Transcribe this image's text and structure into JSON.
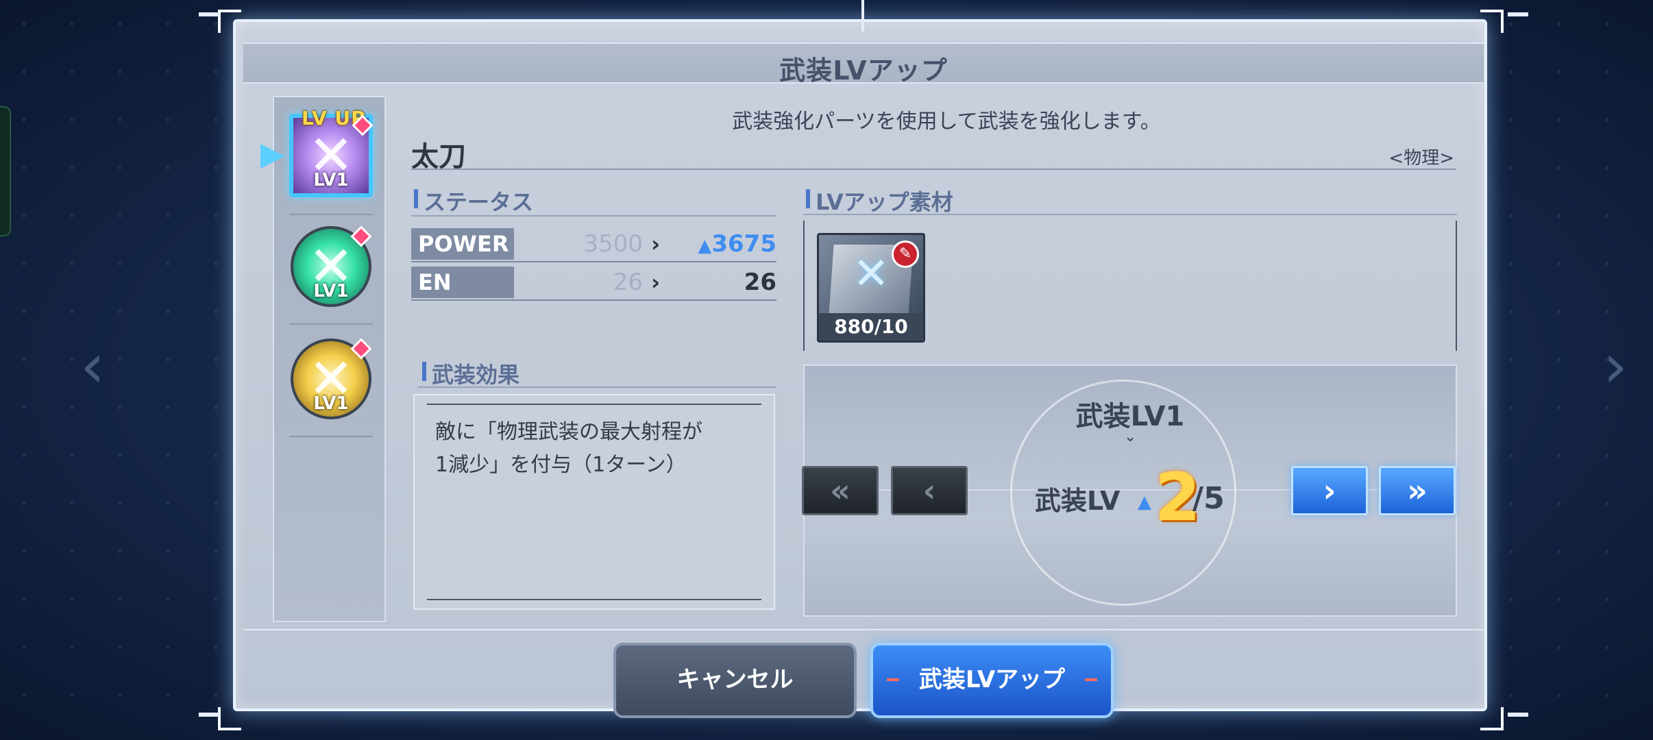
{
  "dialog": {
    "title": "武装LVアップ",
    "description": "武装強化パーツを使用して武装を強化します。"
  },
  "weapon": {
    "name": "太刀",
    "type": "<物理>"
  },
  "weapon_list": [
    {
      "level_label": "LV1",
      "color": "#c9a6ff",
      "selected": true,
      "badge": "LV UP"
    },
    {
      "level_label": "LV1",
      "color": "#35e0a8",
      "selected": false
    },
    {
      "level_label": "LV1",
      "color": "#f3cf4a",
      "selected": false
    }
  ],
  "sections": {
    "status": "ステータス",
    "material": "LVアップ素材",
    "effect": "武装効果"
  },
  "stats": [
    {
      "label": "POWER",
      "current": "3500",
      "next": "3675",
      "increased": true
    },
    {
      "label": "EN",
      "current": "26",
      "next": "26",
      "increased": false
    }
  ],
  "effect": {
    "line1": "敵に「物理武装の最大射程が",
    "line2": "1減少」を付与（1ターン）"
  },
  "material": {
    "count": "880/10",
    "icon": "feather-icon"
  },
  "level": {
    "current_label": "武装LV1",
    "target_label": "武装LV",
    "target_value": "2",
    "max_label": "/5"
  },
  "buttons": {
    "first": "«",
    "prev": "‹",
    "next": "›",
    "last": "»",
    "cancel": "キャンセル",
    "confirm": "武装LVアップ"
  },
  "colors": {
    "accent_blue": "#3f8df0",
    "level_value": "#ffd54a",
    "gem": "#ff4d7d"
  }
}
